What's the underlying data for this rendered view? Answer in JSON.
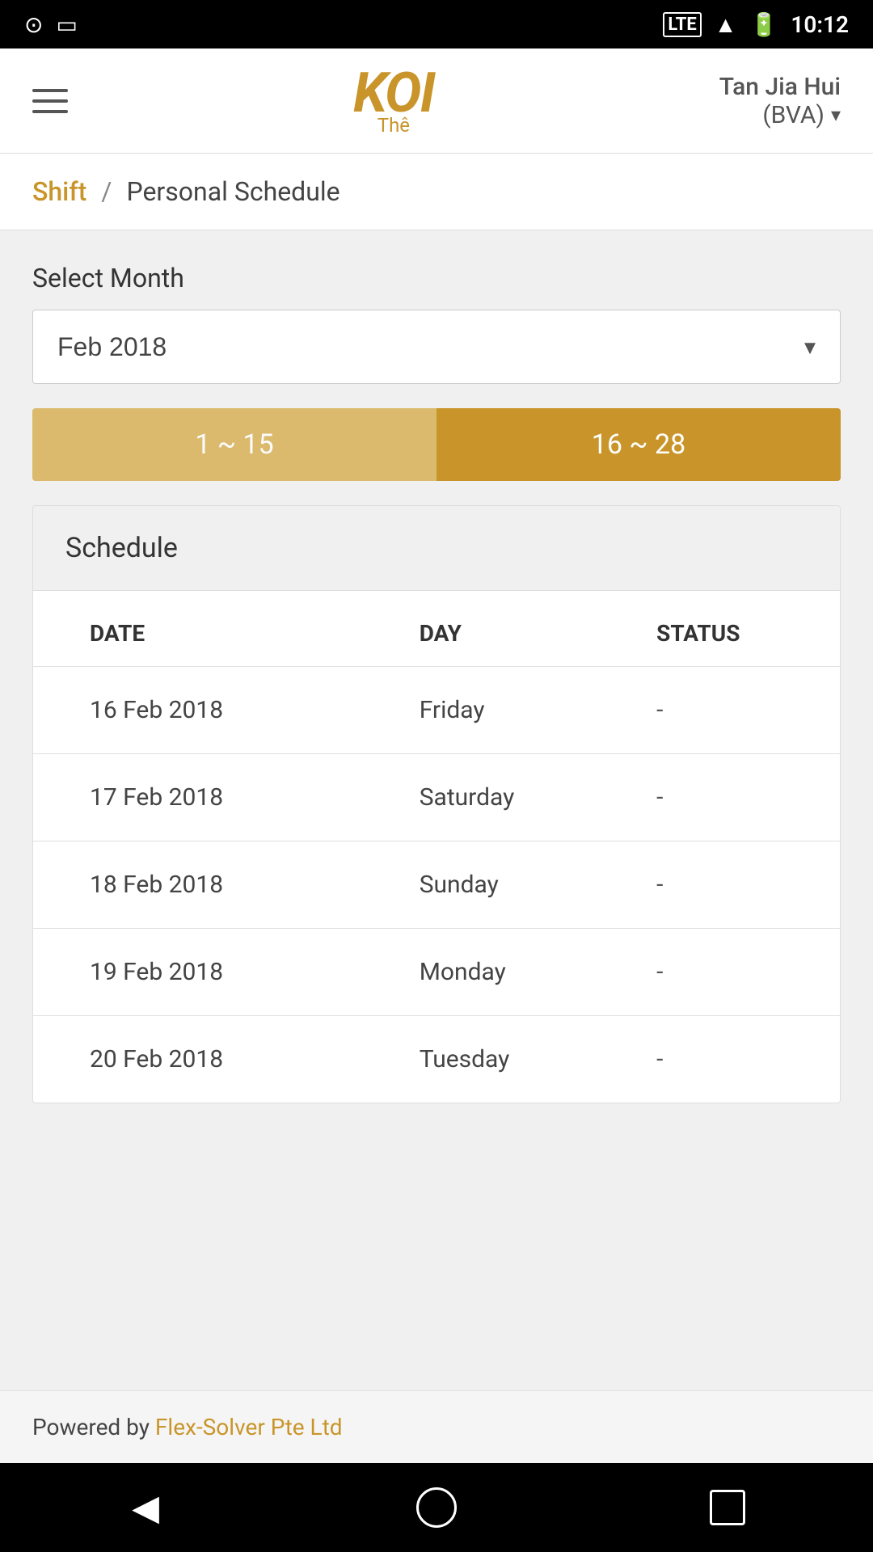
{
  "statusBar": {
    "time": "10:12",
    "lte": "LTE"
  },
  "nav": {
    "logoMain": "KOI",
    "logoSub": "Thê",
    "userName": "Tan Jia Hui",
    "userRole": "(BVA)"
  },
  "breadcrumb": {
    "link": "Shift",
    "separator": "/",
    "current": "Personal Schedule"
  },
  "main": {
    "selectMonthLabel": "Select Month",
    "selectedMonth": "Feb 2018",
    "rangeTabs": [
      {
        "label": "1 ~ 15",
        "state": "inactive"
      },
      {
        "label": "16 ~ 28",
        "state": "active"
      }
    ],
    "scheduleHeader": "Schedule",
    "tableHeaders": {
      "date": "DATE",
      "day": "DAY",
      "status": "STATUS"
    },
    "rows": [
      {
        "date": "16 Feb 2018",
        "day": "Friday",
        "status": "-"
      },
      {
        "date": "17 Feb 2018",
        "day": "Saturday",
        "status": "-"
      },
      {
        "date": "18 Feb 2018",
        "day": "Sunday",
        "status": "-"
      },
      {
        "date": "19 Feb 2018",
        "day": "Monday",
        "status": "-"
      },
      {
        "date": "20 Feb 2018",
        "day": "Tuesday",
        "status": "-"
      }
    ]
  },
  "footer": {
    "prefix": "Powered by ",
    "link": "Flex-Solver Pte Ltd"
  }
}
